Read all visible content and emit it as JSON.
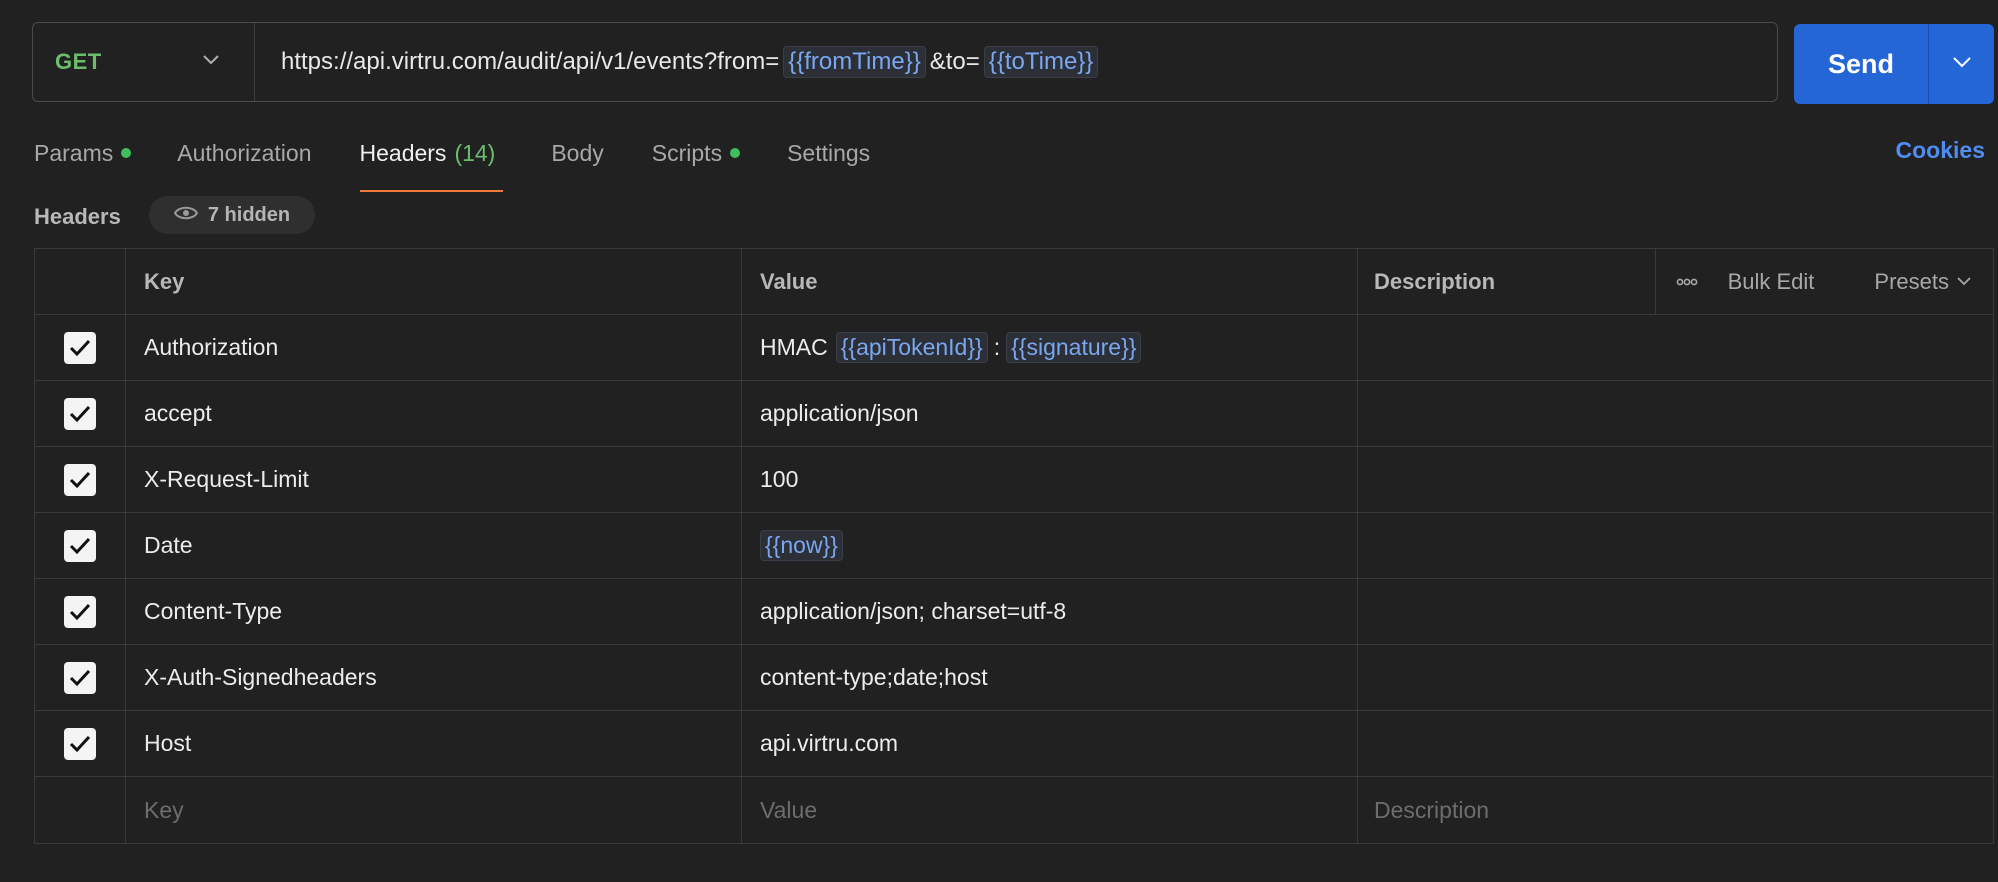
{
  "request": {
    "method": "GET",
    "url_base": "https://api.virtru.com/audit/api/v1/events?from=",
    "var_from": "{{fromTime}}",
    "url_mid": "&to=",
    "var_to": "{{toTime}}",
    "send_label": "Send"
  },
  "tabs": [
    {
      "label": "Params",
      "dot": true
    },
    {
      "label": "Authorization"
    },
    {
      "label": "Headers",
      "count": "(14)",
      "active": true
    },
    {
      "label": "Body"
    },
    {
      "label": "Scripts",
      "dot": true
    },
    {
      "label": "Settings"
    }
  ],
  "cookies_label": "Cookies",
  "headers_section": {
    "title": "Headers",
    "hidden_label": "7 hidden"
  },
  "table": {
    "columns": {
      "key": "Key",
      "value": "Value",
      "description": "Description"
    },
    "bulk_edit": "Bulk Edit",
    "presets": "Presets",
    "rows": [
      {
        "key": "Authorization",
        "value_prefix": "HMAC",
        "var1": "{{apiTokenId}}",
        "sep": ":",
        "var2": "{{signature}}"
      },
      {
        "key": "accept",
        "value": "application/json"
      },
      {
        "key": "X-Request-Limit",
        "value": "100"
      },
      {
        "key": "Date",
        "var1": "{{now}}"
      },
      {
        "key": "Content-Type",
        "value": "application/json; charset=utf-8"
      },
      {
        "key": "X-Auth-Signedheaders",
        "value": "content-type;date;host"
      },
      {
        "key": "Host",
        "value": "api.virtru.com"
      }
    ],
    "placeholders": {
      "key": "Key",
      "value": "Value",
      "description": "Description"
    }
  },
  "colors": {
    "background": "#212121",
    "send": "#2466d6",
    "accent_active_tab": "#f07a3c",
    "method_green": "#6bbd6e",
    "variable_blue": "#7aa7f0",
    "link_blue": "#4f8df2"
  },
  "icons": [
    "chevron-down-icon",
    "eye-icon",
    "more-icon",
    "check-icon"
  ]
}
